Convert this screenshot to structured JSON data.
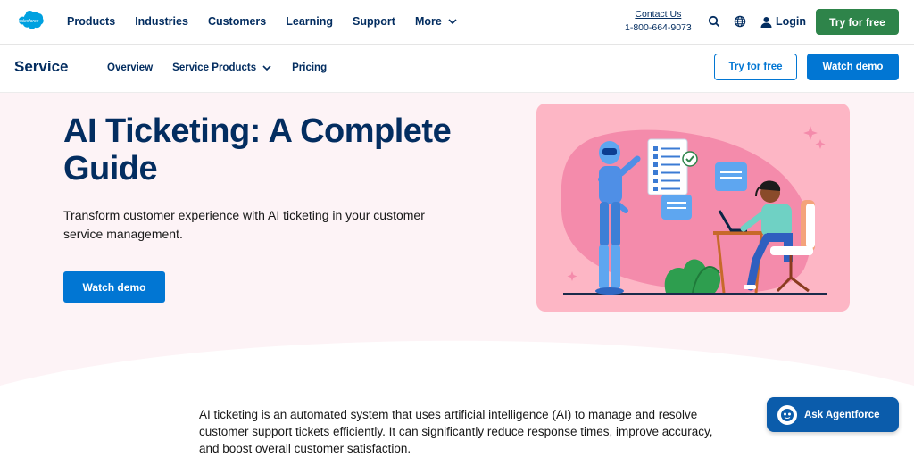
{
  "topnav": {
    "logo_text": "salesforce",
    "items": [
      {
        "label": "Products"
      },
      {
        "label": "Industries"
      },
      {
        "label": "Customers"
      },
      {
        "label": "Learning"
      },
      {
        "label": "Support"
      },
      {
        "label": "More"
      }
    ],
    "contact_label": "Contact Us",
    "phone": "1-800-664-9073",
    "search_icon": "search-icon",
    "globe_icon": "globe-icon",
    "login_label": "Login",
    "try_free_label": "Try for free"
  },
  "subnav": {
    "title": "Service",
    "links": [
      {
        "label": "Overview"
      },
      {
        "label": "Service Products"
      },
      {
        "label": "Pricing"
      }
    ],
    "try_free_label": "Try for free",
    "watch_demo_label": "Watch demo"
  },
  "hero": {
    "title": "AI Ticketing: A Complete Guide",
    "subtitle": "Transform customer experience with AI ticketing in your customer service management.",
    "cta_label": "Watch demo"
  },
  "body": {
    "intro": "AI ticketing is an automated system that uses artificial intelligence (AI) to manage and resolve customer support tickets efficiently. It can significantly reduce response times, improve accuracy, and boost overall customer satisfaction."
  },
  "agentforce": {
    "label": "Ask Agentforce"
  },
  "colors": {
    "brand_navy": "#032d60",
    "brand_blue": "#0176d3",
    "green": "#2e844a",
    "hero_bg": "#fdf3f6",
    "illus_bg": "#fdb6c5"
  }
}
